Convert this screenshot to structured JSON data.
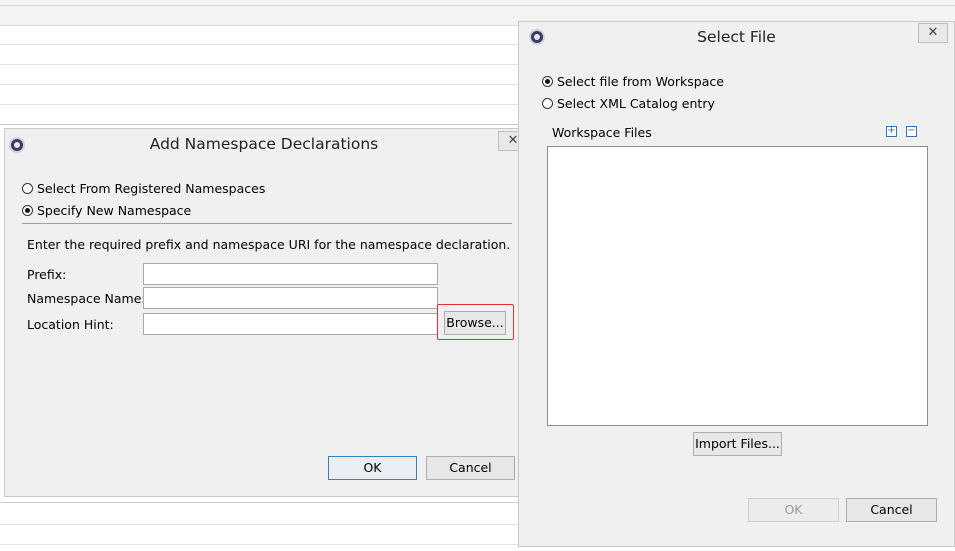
{
  "add_dialog": {
    "title": "Add Namespace Declarations",
    "close_glyph": "✕",
    "options": [
      {
        "label": "Select From Registered Namespaces",
        "checked": false
      },
      {
        "label": "Specify New Namespace",
        "checked": true
      }
    ],
    "instruction": "Enter the required prefix and namespace URI for the namespace declaration.",
    "fields": [
      {
        "label": "Prefix:",
        "value": ""
      },
      {
        "label": "Namespace Name:",
        "value": ""
      },
      {
        "label": "Location Hint:",
        "value": ""
      }
    ],
    "browse_label": "Browse...",
    "ok_label": "OK",
    "cancel_label": "Cancel"
  },
  "select_dialog": {
    "title": "Select File",
    "close_glyph": "✕",
    "options": [
      {
        "label": "Select file from Workspace",
        "checked": true
      },
      {
        "label": "Select XML Catalog entry",
        "checked": false
      }
    ],
    "workspace_label": "Workspace Files",
    "expand_glyph": "+",
    "collapse_glyph": "−",
    "import_label": "Import Files...",
    "ok_label": "OK",
    "cancel_label": "Cancel"
  }
}
